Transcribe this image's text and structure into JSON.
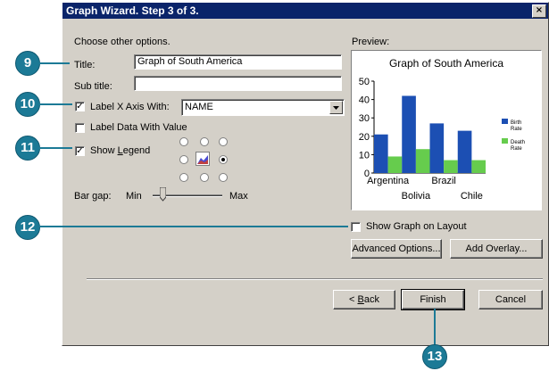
{
  "dialog": {
    "title": "Graph Wizard. Step 3 of 3.",
    "close_glyph": "×",
    "instructions": "Choose other options."
  },
  "form": {
    "title_label": "Title:",
    "title_value": "Graph of South America",
    "subtitle_label": "Sub title:",
    "subtitle_value": "",
    "label_x_axis": {
      "label": "Label X Axis With:",
      "checked": true,
      "value": "NAME"
    },
    "label_data": {
      "label": "Label Data With Value",
      "checked": false
    },
    "show_legend": {
      "label": "Show Legend",
      "checked": true,
      "selected_position": "right"
    },
    "bar_gap": {
      "label": "Bar gap:",
      "min_label": "Min",
      "max_label": "Max",
      "level": 0.05
    },
    "show_graph_on_layout": {
      "label": "Show Graph on Layout",
      "checked": false
    }
  },
  "preview": {
    "label": "Preview:",
    "chart_title": "Graph of South America"
  },
  "chart_data": {
    "type": "bar",
    "title": "Graph of South America",
    "categories": [
      "Argentina",
      "Bolivia",
      "Brazil",
      "Chile"
    ],
    "series": [
      {
        "name": "Birth Rate",
        "values": [
          21,
          42,
          27,
          23
        ],
        "color": "#1c4fb3"
      },
      {
        "name": "Death Rate",
        "values": [
          9,
          13,
          7,
          7
        ],
        "color": "#66cc4d"
      }
    ],
    "ylim": [
      0,
      50
    ],
    "yticks": [
      "0",
      "10",
      "20",
      "30",
      "40",
      "50"
    ],
    "legend_position": "right",
    "legend_labels": [
      [
        "Birth",
        "Rate"
      ],
      [
        "Death",
        "Rate"
      ]
    ]
  },
  "buttons": {
    "advanced": "Advanced Options...",
    "add_overlay": "Add Overlay...",
    "back": "< Back",
    "finish": "Finish",
    "cancel": "Cancel"
  },
  "callouts": [
    "9",
    "10",
    "11",
    "12",
    "13"
  ],
  "colors": {
    "callout": "#1c7a96",
    "titlebar": "#0a246a",
    "dialog": "#d4d0c8"
  }
}
